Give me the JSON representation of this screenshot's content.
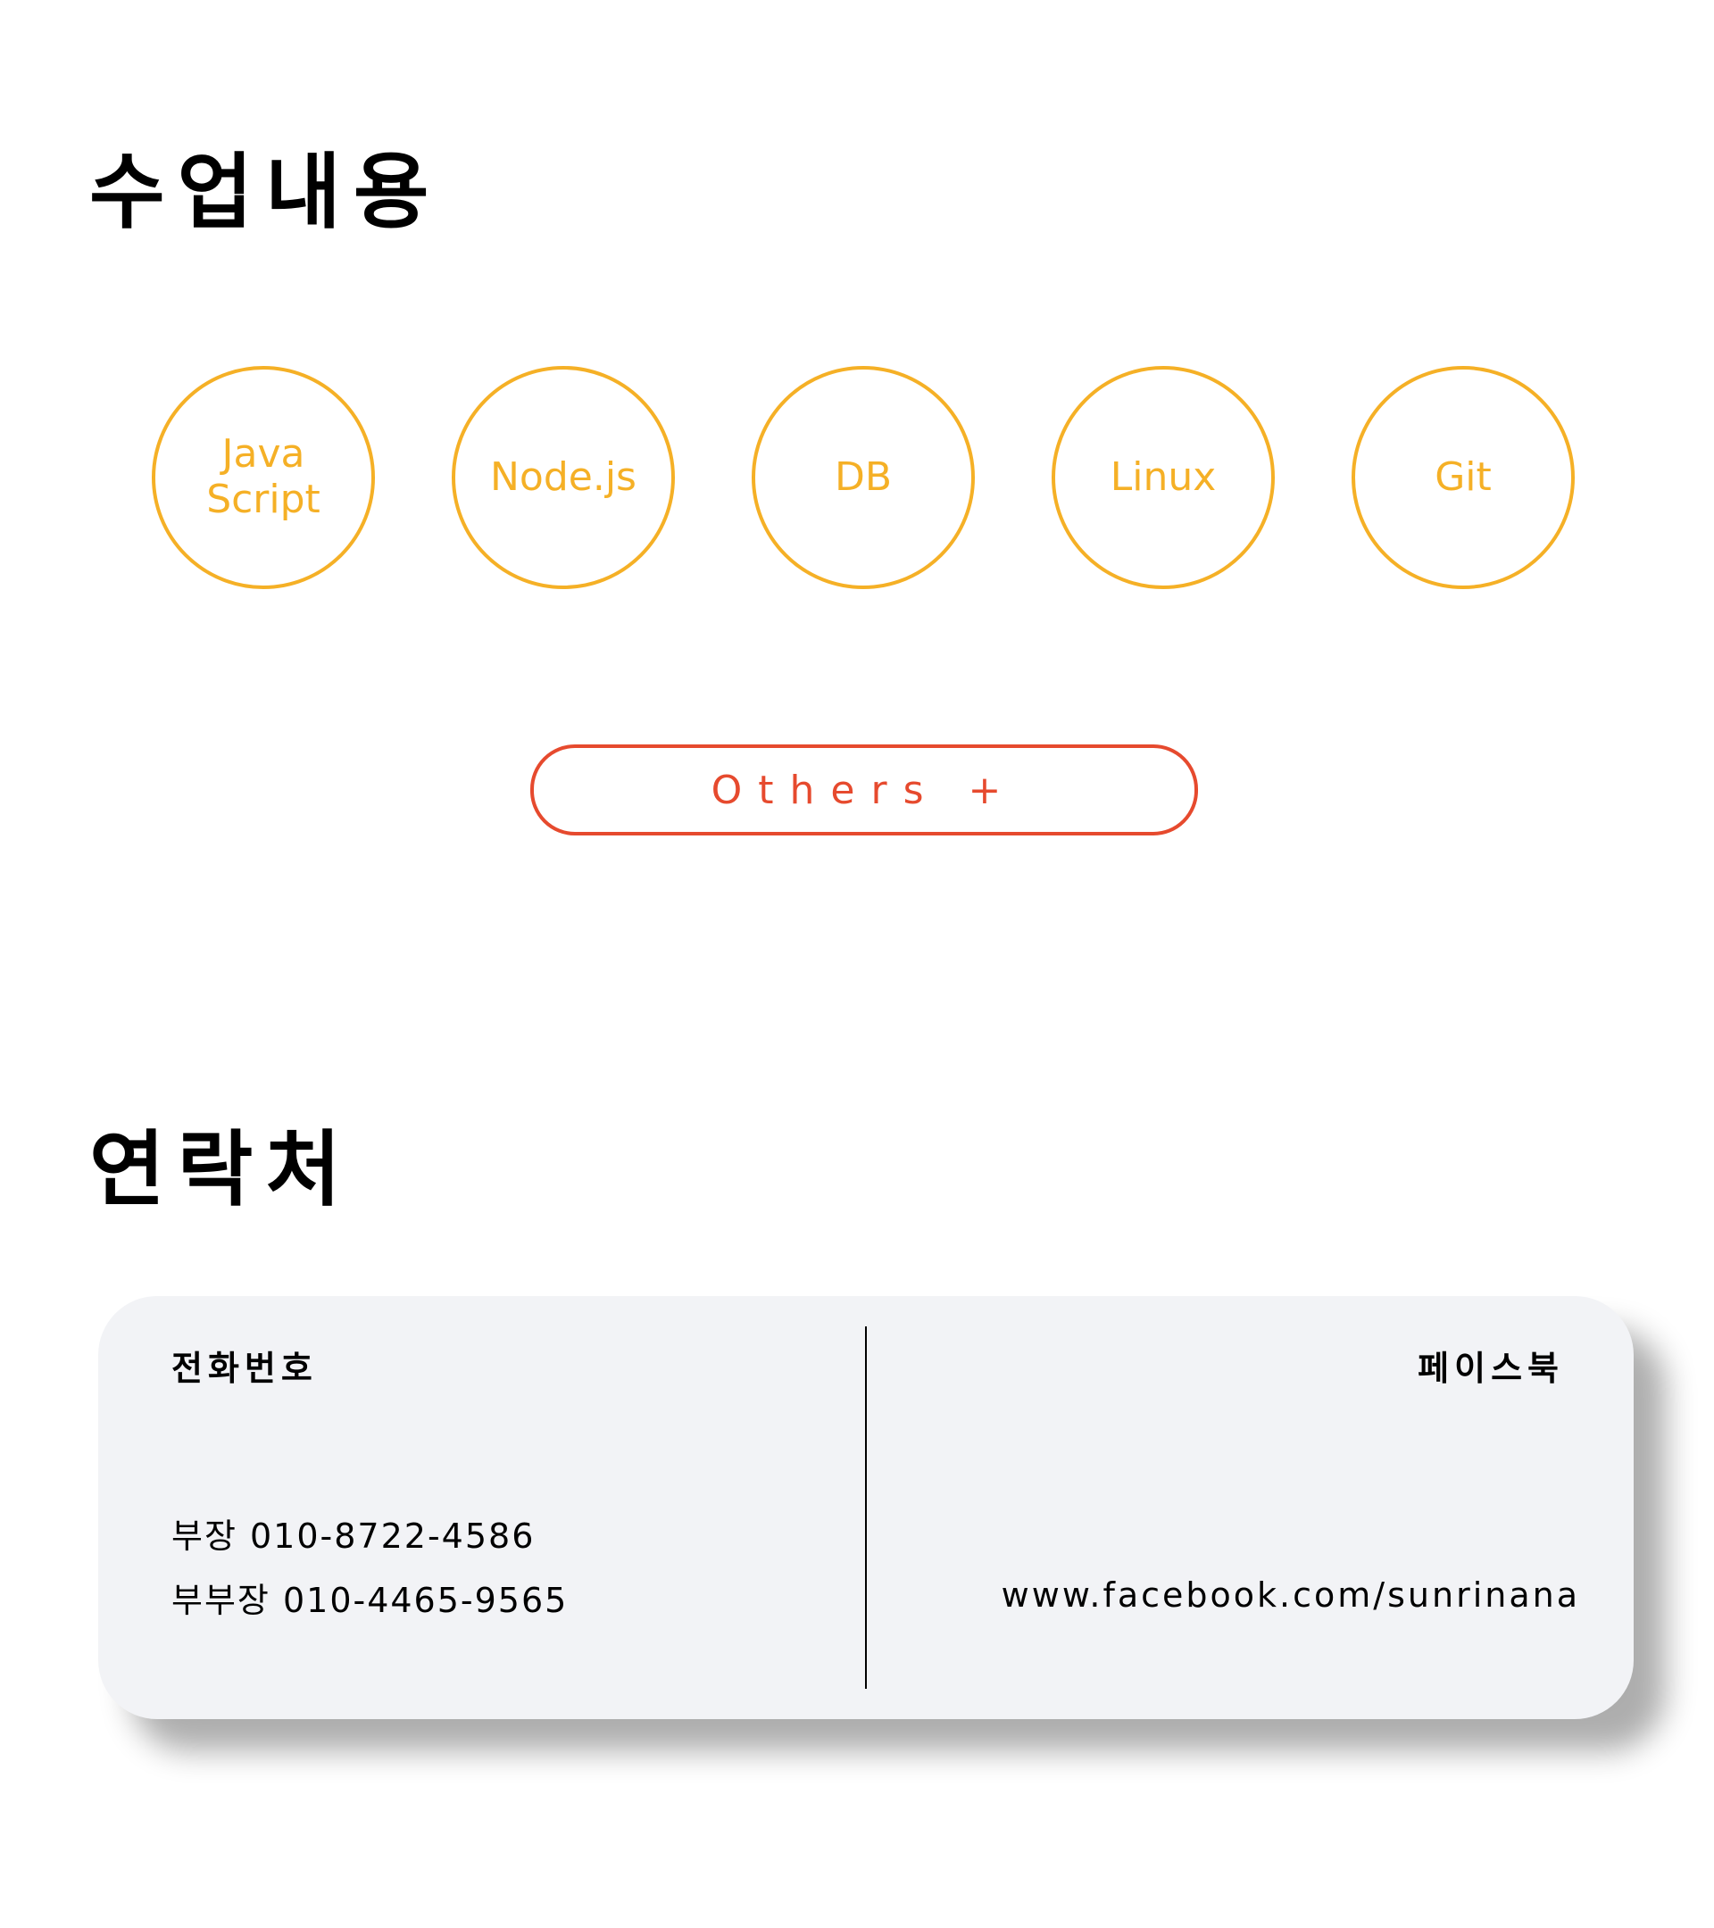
{
  "sections": {
    "classes": {
      "title": "수업내용",
      "items": [
        {
          "label": "Java\nScript"
        },
        {
          "label": "Node.js"
        },
        {
          "label": "DB"
        },
        {
          "label": "Linux"
        },
        {
          "label": "Git"
        }
      ],
      "others_label": "Others +"
    },
    "contact": {
      "title": "연락처",
      "phone": {
        "label": "전화번호",
        "lines": [
          "부장 010-8722-4586",
          "부부장 010-4465-9565"
        ]
      },
      "facebook": {
        "label": "페이스북",
        "url": "www.facebook.com/sunrinana"
      }
    }
  },
  "colors": {
    "circle_accent": "#f5b026",
    "others_accent": "#e64a2e",
    "card_background": "#f2f3f6",
    "text": "#000000"
  }
}
